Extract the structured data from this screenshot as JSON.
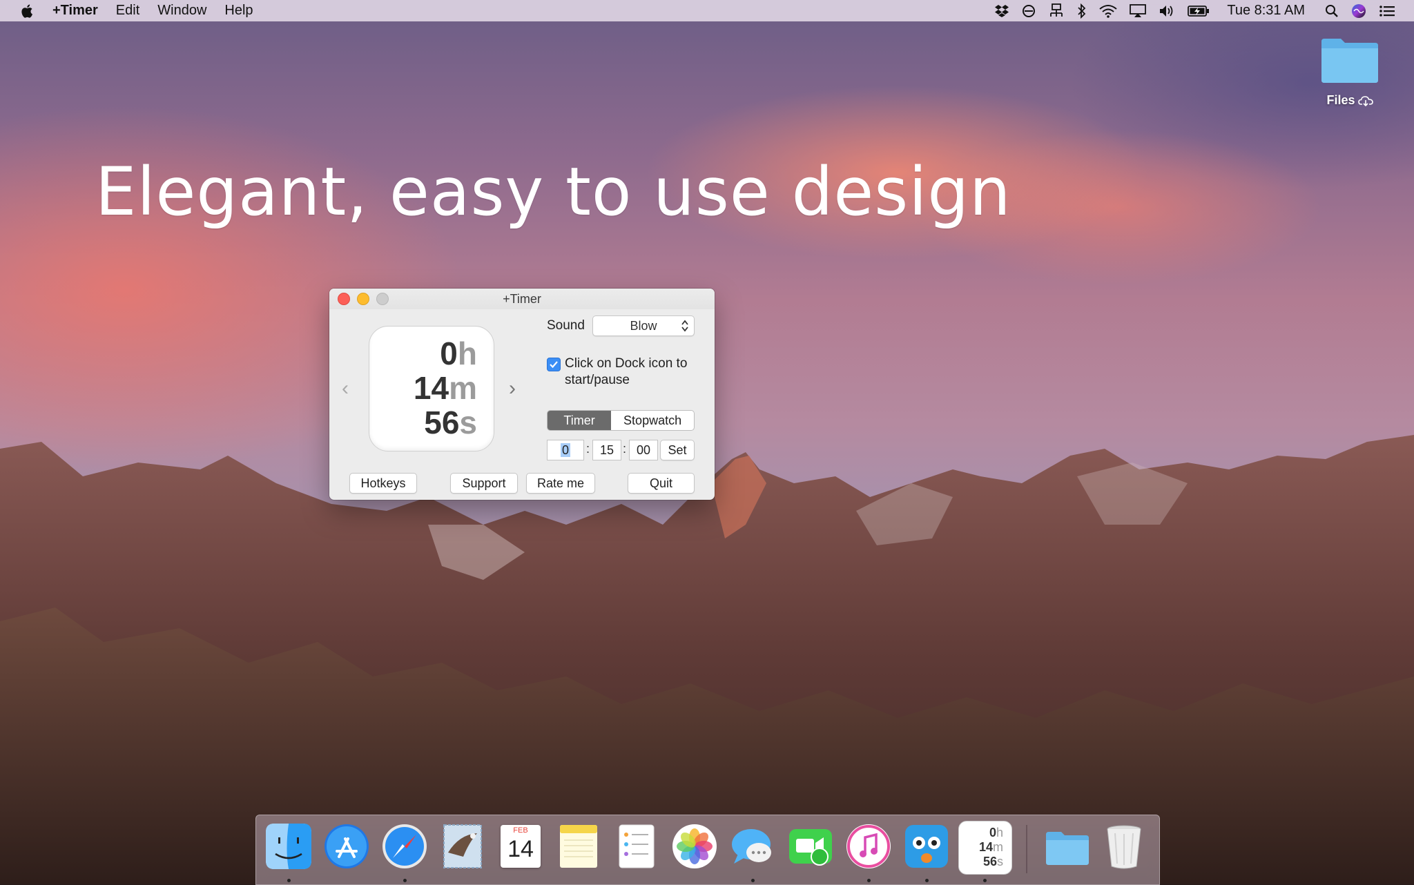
{
  "menubar": {
    "app_name": "+Timer",
    "menus": [
      "Edit",
      "Window",
      "Help"
    ],
    "clock": "Tue 8:31 AM",
    "status_icons": [
      "dropbox-icon",
      "do-not-disturb-icon",
      "network-icon",
      "bluetooth-icon",
      "wifi-icon",
      "airplay-icon",
      "volume-icon",
      "battery-icon",
      "spotlight-icon",
      "siri-icon",
      "notification-center-icon"
    ]
  },
  "desktop": {
    "headline": "Elegant, easy to use design",
    "folder_label": "Files"
  },
  "window": {
    "title": "+Timer",
    "display": {
      "hours": "0",
      "h": "h",
      "minutes": "14",
      "m": "m",
      "seconds": "56",
      "s": "s"
    },
    "sound_label": "Sound",
    "sound_value": "Blow",
    "checkbox_line1": "Click on Dock icon to",
    "checkbox_line2": "start/pause",
    "checkbox_checked": true,
    "mode_timer": "Timer",
    "mode_stopwatch": "Stopwatch",
    "set_hours": "0",
    "set_minutes": "15",
    "set_seconds": "00",
    "colon": ":",
    "set_button": "Set",
    "buttons": {
      "hotkeys": "Hotkeys",
      "support": "Support",
      "rate": "Rate me",
      "quit": "Quit"
    }
  },
  "dock": {
    "apps": [
      "Finder",
      "App Store",
      "Safari",
      "Mail",
      "Calendar",
      "Notes",
      "Reminders",
      "Photos",
      "Messages",
      "FaceTime",
      "iTunes",
      "Tweetbot",
      "+Timer",
      "Folder",
      "Trash"
    ],
    "calendar_month": "FEB",
    "calendar_day": "14",
    "timer_icon": {
      "hours": "0",
      "h": "h",
      "minutes": "14",
      "m": "m",
      "seconds": "56",
      "s": "s"
    }
  },
  "colors": {
    "accent": "#3b8ef5",
    "segment_selected": "#6b6b6b",
    "close": "#fc5f57",
    "minimize": "#fdbc2e"
  }
}
